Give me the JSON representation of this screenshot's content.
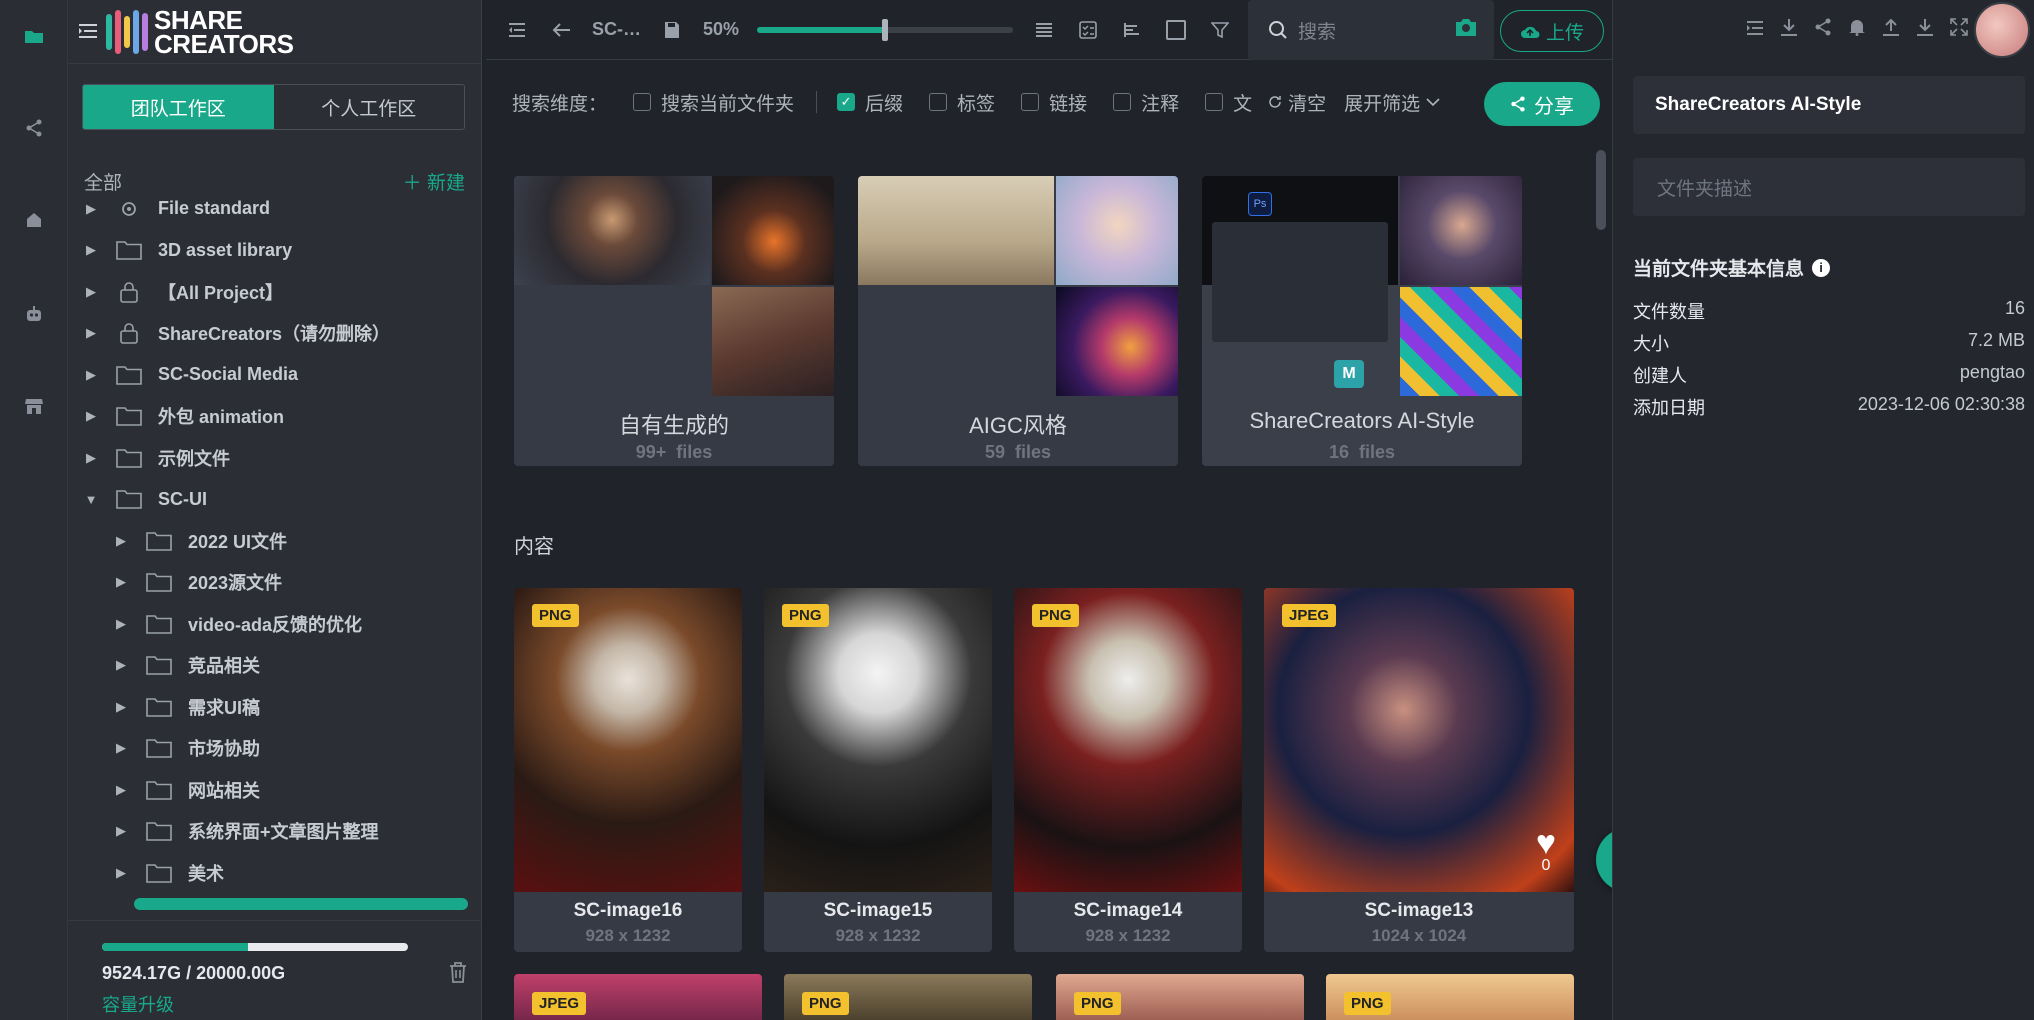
{
  "app": {
    "logo_line1": "SHARE",
    "logo_line2": "CREATORS"
  },
  "colors": {
    "accent": "#19a88a",
    "badge": "#f3c12d",
    "bg": "#20232a"
  },
  "rail_icons": [
    "folder-icon",
    "share-icon",
    "home-icon",
    "robot-icon",
    "store-icon"
  ],
  "workspace": {
    "team_tab": "团队工作区",
    "personal_tab": "个人工作区"
  },
  "tree": {
    "all_label": "全部",
    "new_label": "新建",
    "items": [
      {
        "label": "File standard",
        "icon": "gear-icon",
        "expanded": false
      },
      {
        "label": "3D asset library",
        "icon": "folder-icon",
        "expanded": false
      },
      {
        "label": "【All Project】",
        "icon": "lock-icon",
        "expanded": false
      },
      {
        "label": "ShareCreators（请勿删除）",
        "icon": "lock-icon",
        "expanded": false
      },
      {
        "label": "SC-Social Media",
        "icon": "folder-icon",
        "expanded": false
      },
      {
        "label": "外包 animation",
        "icon": "folder-icon",
        "expanded": false
      },
      {
        "label": "示例文件",
        "icon": "folder-icon",
        "expanded": false
      },
      {
        "label": "SC-UI",
        "icon": "folder-icon",
        "expanded": true
      },
      {
        "label": "2022 UI文件",
        "icon": "folder-icon",
        "expanded": false,
        "child": true
      },
      {
        "label": "2023源文件",
        "icon": "folder-icon",
        "expanded": false,
        "child": true
      },
      {
        "label": "video-ada反馈的优化",
        "icon": "folder-icon",
        "expanded": false,
        "child": true
      },
      {
        "label": "竞品相关",
        "icon": "folder-icon",
        "expanded": false,
        "child": true
      },
      {
        "label": "需求UI稿",
        "icon": "folder-icon",
        "expanded": false,
        "child": true
      },
      {
        "label": "市场协助",
        "icon": "folder-icon",
        "expanded": false,
        "child": true
      },
      {
        "label": "网站相关",
        "icon": "folder-icon",
        "expanded": false,
        "child": true
      },
      {
        "label": "系统界面+文章图片整理",
        "icon": "folder-icon",
        "expanded": false,
        "child": true
      },
      {
        "label": "美术",
        "icon": "folder-icon",
        "expanded": false,
        "child": true
      }
    ]
  },
  "storage": {
    "used_fraction": 0.476,
    "text": "9524.17G / 20000.00G",
    "upgrade": "容量升级"
  },
  "toolbar": {
    "breadcrumb": "SC-…",
    "zoom": "50%",
    "zoom_fraction": 0.5,
    "search_placeholder": "搜索",
    "upload_label": "上传"
  },
  "filter": {
    "label": "搜索维度：",
    "options": [
      {
        "label": "搜索当前文件夹",
        "checked": false
      },
      {
        "label": "后缀",
        "checked": true
      },
      {
        "label": "标签",
        "checked": false
      },
      {
        "label": "链接",
        "checked": false
      },
      {
        "label": "注释",
        "checked": false
      },
      {
        "label": "文",
        "checked": false
      }
    ],
    "clear": "清空",
    "expand": "展开筛选",
    "share": "分享"
  },
  "folders": [
    {
      "name": "自有生成的",
      "count": "99+",
      "unit": "files"
    },
    {
      "name": "AIGC风格",
      "count": "59",
      "unit": "files"
    },
    {
      "name": "ShareCreators AI-Style",
      "count": "16",
      "unit": "files"
    }
  ],
  "content_title": "内容",
  "images": [
    {
      "badge": "PNG",
      "name": "SC-image16",
      "dims": "928 x 1232"
    },
    {
      "badge": "PNG",
      "name": "SC-image15",
      "dims": "928 x 1232"
    },
    {
      "badge": "PNG",
      "name": "SC-image14",
      "dims": "928 x 1232"
    },
    {
      "badge": "JPEG",
      "name": "SC-image13",
      "dims": "1024 x 1024",
      "likes": "0"
    }
  ],
  "next_row_badges": [
    "JPEG",
    "PNG",
    "PNG",
    "PNG"
  ],
  "right_panel": {
    "title": "ShareCreators AI-Style",
    "desc_placeholder": "文件夹描述",
    "info_title": "当前文件夹基本信息",
    "rows": [
      {
        "k": "文件数量",
        "v": "16"
      },
      {
        "k": "大小",
        "v": "7.2 MB"
      },
      {
        "k": "创建人",
        "v": "pengtao"
      },
      {
        "k": "添加日期",
        "v": "2023-12-06 02:30:38"
      }
    ]
  }
}
